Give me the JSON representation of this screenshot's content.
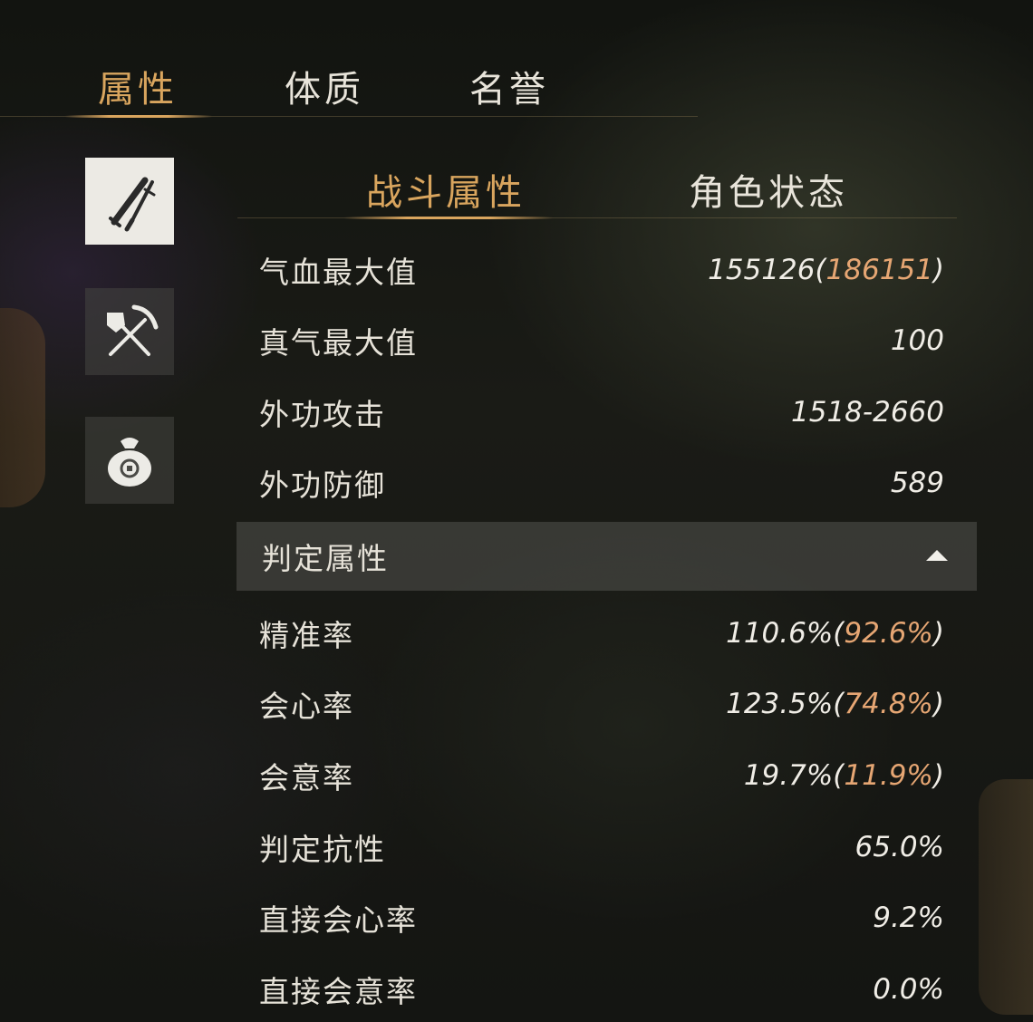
{
  "top_tabs": [
    {
      "label": "属性",
      "active": true
    },
    {
      "label": "体质",
      "active": false
    },
    {
      "label": "名誉",
      "active": false
    }
  ],
  "side_icons": [
    {
      "icon": "weapons-icon",
      "active": true
    },
    {
      "icon": "shovel-pickaxe-icon",
      "active": false
    },
    {
      "icon": "money-bag-icon",
      "active": false
    }
  ],
  "sub_tabs": [
    {
      "label": "战斗属性",
      "active": true
    },
    {
      "label": "角色状态",
      "active": false
    }
  ],
  "combat_stats": [
    {
      "label": "气血最大值",
      "value": "155126",
      "bonus": "186151"
    },
    {
      "label": "真气最大值",
      "value": "100"
    },
    {
      "label": "外功攻击",
      "value": "1518-2660"
    },
    {
      "label": "外功防御",
      "value": "589"
    }
  ],
  "judgement_section": {
    "title": "判定属性",
    "expanded": true,
    "stats": [
      {
        "label": "精准率",
        "value": "110.6%",
        "bonus": "92.6%"
      },
      {
        "label": "会心率",
        "value": "123.5%",
        "bonus": "74.8%"
      },
      {
        "label": "会意率",
        "value": "19.7%",
        "bonus": "11.9%"
      },
      {
        "label": "判定抗性",
        "value": "65.0%"
      },
      {
        "label": "直接会心率",
        "value": "9.2%"
      },
      {
        "label": "直接会意率",
        "value": "0.0%"
      }
    ]
  },
  "colors": {
    "accent": "#d9a55e",
    "bonus": "#e6a673"
  }
}
